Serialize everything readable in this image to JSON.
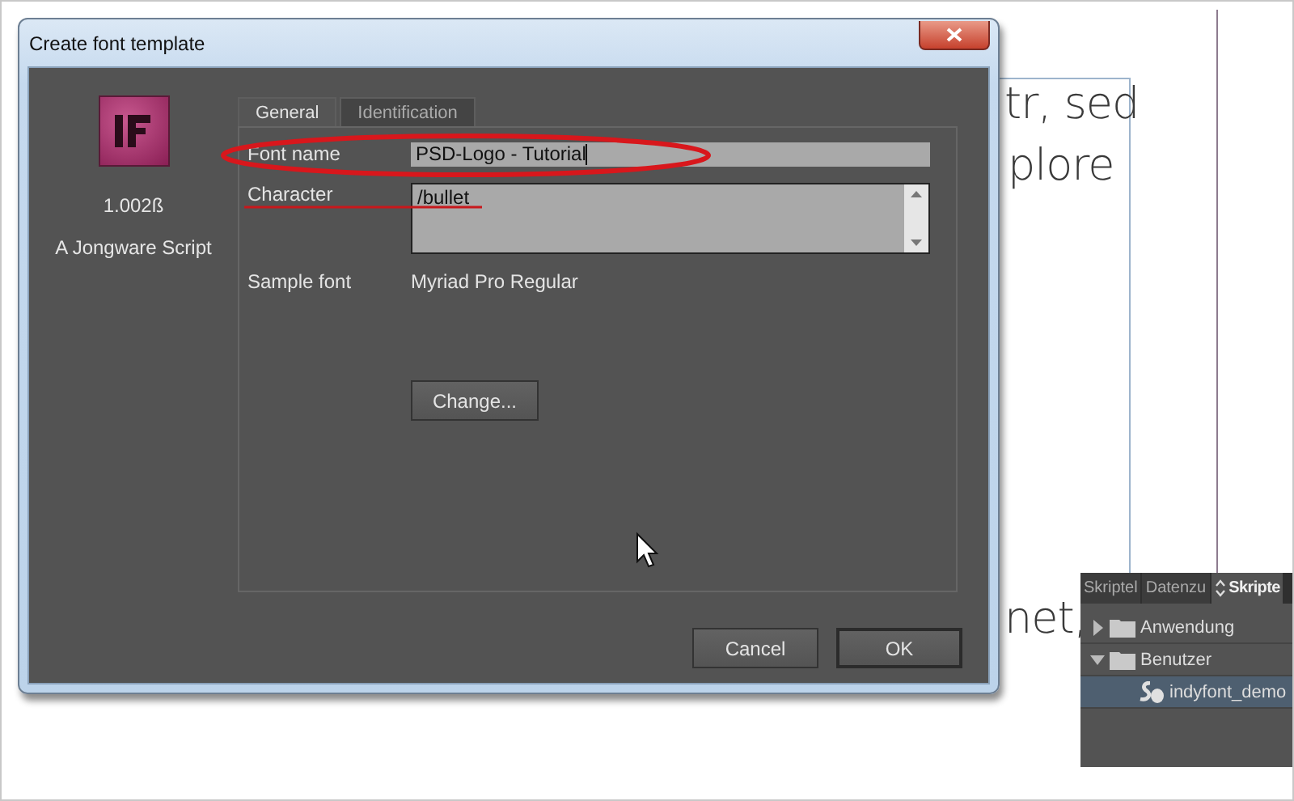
{
  "document": {
    "text_fragments": [
      {
        "text": "tr, sed"
      },
      {
        "text": "plore"
      },
      {
        "text": "net,"
      }
    ]
  },
  "dialog": {
    "title": "Create font template",
    "about": {
      "version": "1.002ß",
      "author": "A Jongware Script"
    },
    "tabs": [
      {
        "label": "General",
        "selected": true
      },
      {
        "label": "Identification",
        "selected": false
      }
    ],
    "fields": [
      {
        "kind": "text",
        "label": "Font name",
        "value": "PSD-Logo - Tutorial"
      },
      {
        "kind": "textarea",
        "label": "Character",
        "value": "/bullet"
      },
      {
        "kind": "static",
        "label": "Sample font",
        "value": "Myriad Pro Regular"
      }
    ],
    "change_button": "Change...",
    "buttons": [
      {
        "label": "Cancel",
        "default": false
      },
      {
        "label": "OK",
        "default": true
      }
    ]
  },
  "scripts_panel": {
    "tabs": [
      {
        "label": "Skriptel",
        "selected": false
      },
      {
        "label": "Datenzu",
        "selected": false
      },
      {
        "label": "Skripte",
        "selected": true
      }
    ],
    "tree": [
      {
        "kind": "folder",
        "label": "Anwendung",
        "expanded": false,
        "selected": false
      },
      {
        "kind": "folder",
        "label": "Benutzer",
        "expanded": true,
        "selected": false,
        "children": [
          {
            "kind": "script",
            "label": "indyfont_demo",
            "selected": true
          }
        ]
      }
    ]
  }
}
